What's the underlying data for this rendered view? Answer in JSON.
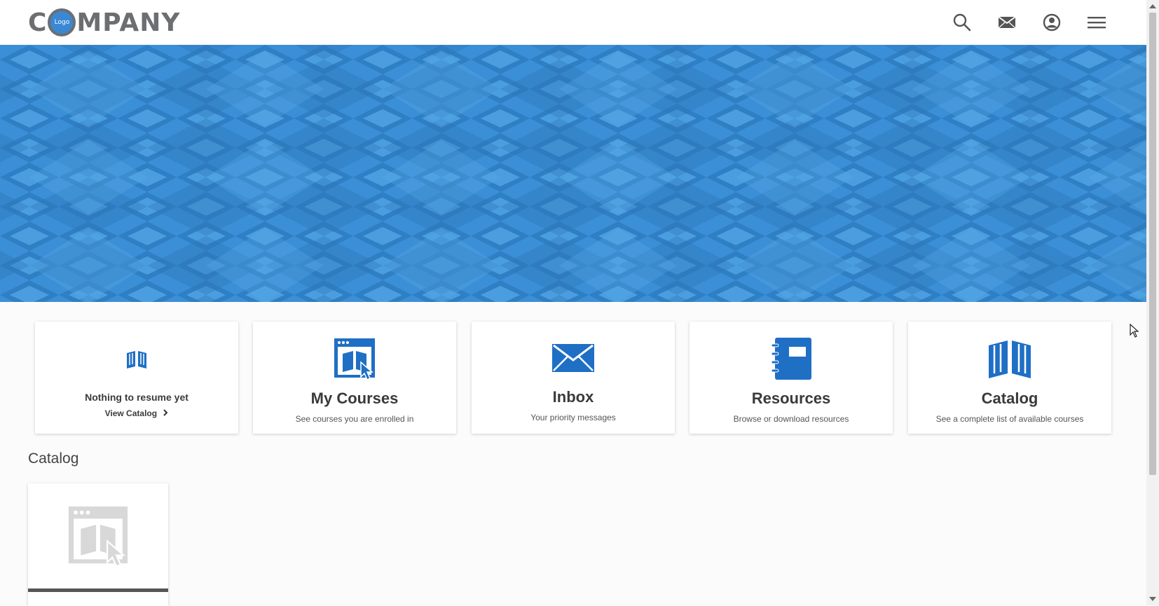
{
  "brand": {
    "logo_prefix": "C",
    "logo_badge": "Logo",
    "logo_suffix": "MPANY"
  },
  "header": {
    "icons": [
      "search-icon",
      "mail-icon",
      "user-account-icon",
      "hamburger-menu-icon"
    ]
  },
  "tiles": {
    "resume": {
      "title": "Nothing to resume yet",
      "link": "View Catalog",
      "link_icon": "chevron-right-icon"
    },
    "my_courses": {
      "title": "My Courses",
      "subtitle": "See courses you are enrolled in"
    },
    "inbox": {
      "title": "Inbox",
      "subtitle": "Your priority messages"
    },
    "resources": {
      "title": "Resources",
      "subtitle": "Browse or download resources"
    },
    "catalog": {
      "title": "Catalog",
      "subtitle": "See a complete list of available courses"
    }
  },
  "catalog_section": {
    "title": "Catalog"
  },
  "colors": {
    "accent": "#1f6fc5",
    "banner": "#3b8fd6",
    "logo_gray": "#6d6e71"
  }
}
